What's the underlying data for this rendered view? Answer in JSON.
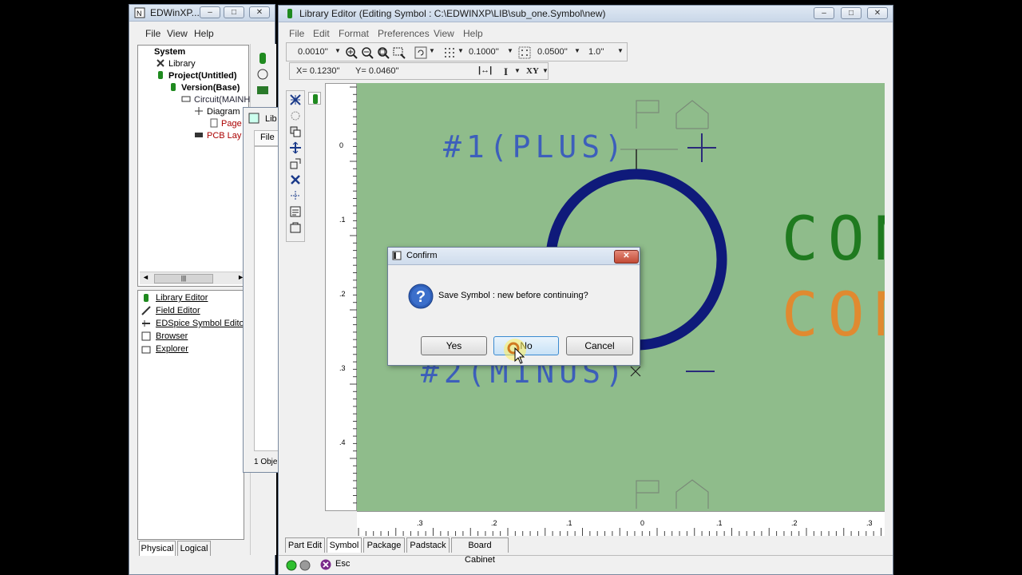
{
  "edwin": {
    "title": "EDWinXP...",
    "menu": [
      "File",
      "View",
      "Help"
    ],
    "tree": {
      "system": "System",
      "library": "Library",
      "project": "Project(Untitled)",
      "version": "Version(Base)",
      "circuit": "Circuit(MAINHI",
      "diagram": "Diagram",
      "page": "Page",
      "pcb": "PCB Lay"
    },
    "scroll_thumb": "|||",
    "tools": [
      "Library Editor",
      "Field Editor",
      "EDSpice Symbol Editor",
      "Browser",
      "Explorer"
    ],
    "tabs": [
      "Physical",
      "Logical"
    ]
  },
  "libwin2": {
    "title": "Lib",
    "menu": "File",
    "status": "1 Obje"
  },
  "editor": {
    "title": "Library Editor (Editing Symbol : C:\\EDWINXP\\LIB\\sub_one.Symbol\\new)",
    "menu": [
      "File",
      "Edit",
      "Format",
      "Preferences",
      "View",
      "Help"
    ],
    "toolbar": {
      "grid": "0.0010''",
      "snap": "0.1000''",
      "step": "0.0500''",
      "line": "1.0''"
    },
    "coords": {
      "x": "X= 0.1230''",
      "y": "Y= 0.0460''",
      "text_tool": "I",
      "xy": "XY"
    },
    "vruler": [
      "0",
      ".1",
      ".2",
      ".3",
      ".4"
    ],
    "hruler": [
      ".3",
      ".2",
      ".1",
      "0",
      ".1",
      ".2",
      ".3"
    ],
    "canvas": {
      "pin1": "#1(PLUS)",
      "pin2": "#2(MINUS)",
      "big_text_1": "CON",
      "big_text_2": "CON"
    },
    "tabs": [
      "Part Edit",
      "Symbol",
      "Package",
      "Padstack",
      "Board Cabinet"
    ],
    "status": {
      "esc": "Esc"
    }
  },
  "dialog": {
    "title": "Confirm",
    "message": "Save  Symbol : new before continuing?",
    "buttons": {
      "yes": "Yes",
      "no": "No",
      "cancel": "Cancel"
    }
  },
  "colors": {
    "canvas": "#8fbc8b",
    "circle": "#0f1a7a",
    "pin_text": "#2f4fc4",
    "big_text_1": "#1f7a1f",
    "big_text_2": "#e08a30"
  }
}
